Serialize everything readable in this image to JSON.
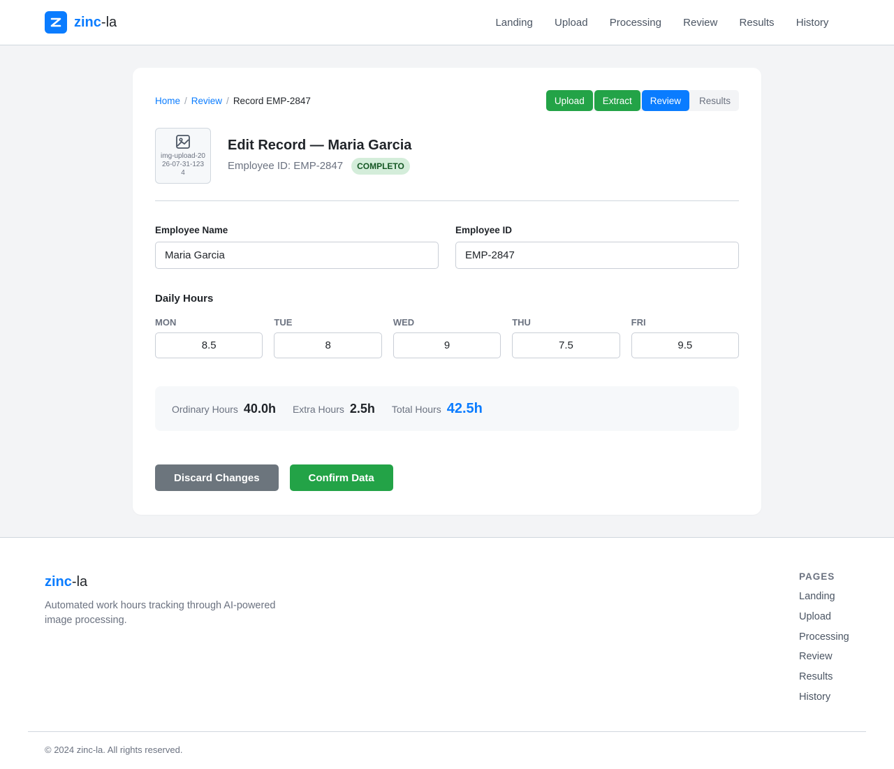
{
  "header": {
    "brand_accent": "zinc",
    "brand_rest": "-la",
    "nav": [
      "Landing",
      "Upload",
      "Processing",
      "Review",
      "Results",
      "History"
    ]
  },
  "breadcrumb": {
    "home": "Home",
    "review": "Review",
    "current": "Record EMP-2847"
  },
  "steps": [
    {
      "label": "Upload",
      "state": "done"
    },
    {
      "label": "Extract",
      "state": "done"
    },
    {
      "label": "Review",
      "state": "active"
    },
    {
      "label": "Results",
      "state": "pending"
    }
  ],
  "record": {
    "thumb_caption": "img-upload-2026-07-31-1234",
    "thumb_icon": "image-icon",
    "title": "Edit Record — Maria Garcia",
    "employee_id_text": "Employee ID: EMP-2847",
    "status_badge": "COMPLETO"
  },
  "form": {
    "name_label": "Employee Name",
    "name_value": "Maria Garcia",
    "id_label": "Employee ID",
    "id_value": "EMP-2847"
  },
  "daily": {
    "title": "Daily Hours",
    "days": [
      {
        "label": "MON",
        "value": "8.5"
      },
      {
        "label": "TUE",
        "value": "8"
      },
      {
        "label": "WED",
        "value": "9"
      },
      {
        "label": "THU",
        "value": "7.5"
      },
      {
        "label": "FRI",
        "value": "9.5"
      }
    ]
  },
  "summary": {
    "ordinary_label": "Ordinary Hours",
    "ordinary_value": "40.0h",
    "extra_label": "Extra Hours",
    "extra_value": "2.5h",
    "total_label": "Total Hours",
    "total_value": "42.5h"
  },
  "actions": {
    "discard": "Discard Changes",
    "confirm": "Confirm Data"
  },
  "footer": {
    "brand_accent": "zinc",
    "brand_rest": "-la",
    "description": "Automated work hours tracking through AI-powered image processing.",
    "pages_heading": "PAGES",
    "links": [
      "Landing",
      "Upload",
      "Processing",
      "Review",
      "Results",
      "History"
    ],
    "copyright": "© 2024 zinc-la. All rights reserved."
  },
  "colors": {
    "accent": "#0a7cff",
    "success": "#23a347",
    "neutral_button": "#6c757d",
    "badge_bg": "#d4edda",
    "badge_text": "#155724"
  }
}
